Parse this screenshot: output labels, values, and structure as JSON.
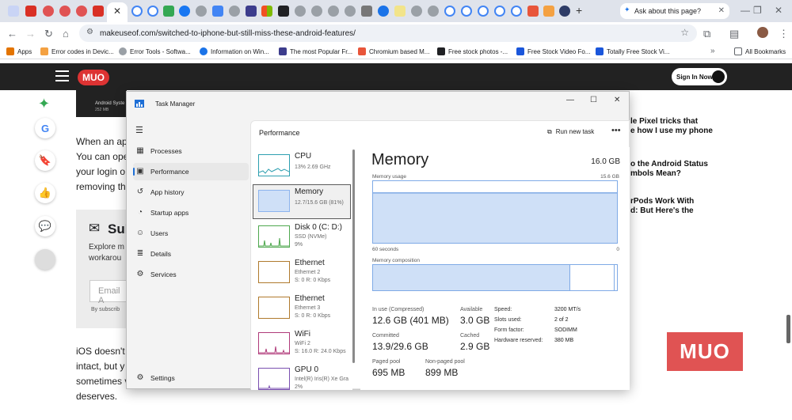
{
  "browser": {
    "ask_tab_label": "Ask about this page?",
    "url": "makeuseof.com/switched-to-iphone-but-still-miss-these-android-features/",
    "bookmarks": [
      "Apps",
      "Error codes in Devic...",
      "Error Tools - Softwa...",
      "Information on Win...",
      "The most Popular Fr...",
      "Chromium based M...",
      "Free stock photos -...",
      "Free Stock Video Fo...",
      "Totally Free Stock Vi..."
    ],
    "all_bookmarks_label": "All Bookmarks"
  },
  "site": {
    "logo": "MUO",
    "signin_label": "Sign In Now",
    "big_logo": "MUO"
  },
  "article": {
    "para1": [
      "When an app",
      "You can ope",
      "your login o",
      "removing th"
    ],
    "subscribe_title": "Sub",
    "subscribe_lines": [
      "Explore m",
      "workarou"
    ],
    "email_placeholder": "Email A",
    "by_subscribing": "By subscrib",
    "para2": [
      "iOS doesn't c",
      "intact, but y",
      "sometimes v",
      "deserves."
    ],
    "thumb_caption": "Android Syste",
    "thumb_size": "252 MB"
  },
  "related": [
    {
      "lines": [
        "le Pixel tricks that",
        "e how I use my phone"
      ]
    },
    {
      "lines": [
        "o the Android Status",
        "mbols Mean?"
      ]
    },
    {
      "lines": [
        "rPods Work With",
        "d: But Here's the"
      ]
    }
  ],
  "taskmanager": {
    "title": "Task Manager",
    "nav": [
      "Processes",
      "Performance",
      "App history",
      "Startup apps",
      "Users",
      "Details",
      "Services"
    ],
    "settings_label": "Settings",
    "header_title": "Performance",
    "run_new_task": "Run new task",
    "devices": [
      {
        "name": "CPU",
        "sub": [
          "13%  2.69 GHz"
        ]
      },
      {
        "name": "Memory",
        "sub": [
          "12.7/15.6 GB (81%)"
        ]
      },
      {
        "name": "Disk 0 (C: D:)",
        "sub": [
          "SSD (NVMe)",
          "9%"
        ]
      },
      {
        "name": "Ethernet",
        "sub": [
          "Ethernet 2",
          "S: 0  R: 0 Kbps"
        ]
      },
      {
        "name": "Ethernet",
        "sub": [
          "Ethernet 3",
          "S: 0  R: 0 Kbps"
        ]
      },
      {
        "name": "WiFi",
        "sub": [
          "WiFi 2",
          "S: 16.0  R: 24.0 Kbps"
        ]
      },
      {
        "name": "GPU 0",
        "sub": [
          "Intel(R) Iris(R) Xe Gra",
          "2%"
        ]
      }
    ],
    "memory": {
      "heading": "Memory",
      "total": "16.0 GB",
      "usage_label": "Memory usage",
      "usage_max": "15.6 GB",
      "time_left": "60 seconds",
      "time_right": "0",
      "composition_label": "Memory composition",
      "usage_fraction": 0.81,
      "composition_in_use_fraction": 0.81,
      "composition_standby_fraction": 0.18,
      "in_use_label": "In use (Compressed)",
      "in_use_value": "12.6 GB (401 MB)",
      "available_label": "Available",
      "available_value": "3.0 GB",
      "committed_label": "Committed",
      "committed_value": "13.9/29.6 GB",
      "cached_label": "Cached",
      "cached_value": "2.9 GB",
      "paged_label": "Paged pool",
      "paged_value": "695 MB",
      "nonpaged_label": "Non-paged pool",
      "nonpaged_value": "899 MB",
      "kv": [
        {
          "k": "Speed:",
          "v": "3200 MT/s"
        },
        {
          "k": "Slots used:",
          "v": "2 of 2"
        },
        {
          "k": "Form factor:",
          "v": "SODIMM"
        },
        {
          "k": "Hardware reserved:",
          "v": "380 MB"
        }
      ]
    }
  },
  "colors": {
    "accent_mem": "#7faae6",
    "accent_fill": "#cfe0f7",
    "muo_red": "#e05353"
  }
}
